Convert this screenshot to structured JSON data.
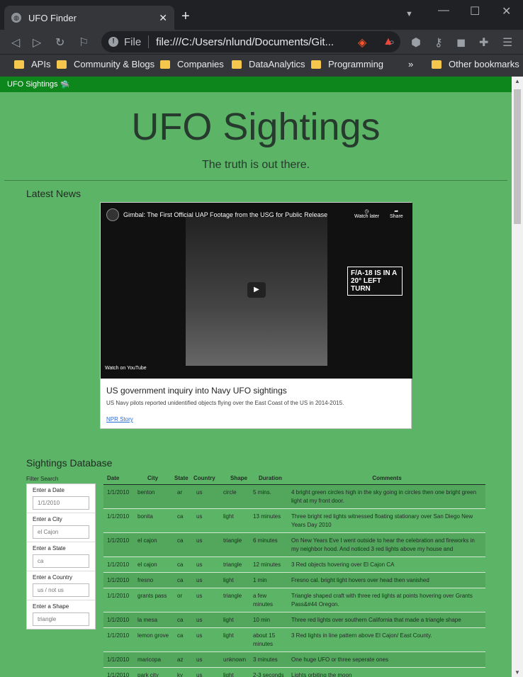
{
  "browser": {
    "tab_title": "UFO Finder",
    "address": "file:///C:/Users/nlund/Documents/Git...",
    "scheme_label": "File",
    "bookmarks": [
      "APIs",
      "Community & Blogs",
      "Companies",
      "DataAnalytics",
      "Programming"
    ],
    "other_bookmarks": "Other bookmarks"
  },
  "navbar": {
    "brand": "UFO Sightings"
  },
  "jumbotron": {
    "title": "UFO Sightings",
    "subtitle": "The truth is out there."
  },
  "news": {
    "heading": "Latest News",
    "video_title": "Gimbal: The First Official UAP Footage from the USG for Public Release",
    "overlay_text": "F/A-18 IS IN A 20° LEFT TURN",
    "watch_later": "Watch later",
    "share": "Share",
    "watch_on": "Watch on YouTube",
    "card_title": "US government inquiry into Navy UFO sightings",
    "card_text": "US Navy pilots reported unidentified objects flying over the East Coast of the US in 2014-2015.",
    "card_link": "NPR Story"
  },
  "database": {
    "heading": "Sightings Database",
    "filter_label": "Filter Search",
    "filters": [
      {
        "label": "Enter a Date",
        "placeholder": "1/1/2010"
      },
      {
        "label": "Enter a City",
        "placeholder": "el Cajon"
      },
      {
        "label": "Enter a State",
        "placeholder": "ca"
      },
      {
        "label": "Enter a Country",
        "placeholder": "us / not us"
      },
      {
        "label": "Enter a Shape",
        "placeholder": "triangle"
      }
    ],
    "columns": [
      "Date",
      "City",
      "State",
      "Country",
      "Shape",
      "Duration",
      "Comments"
    ],
    "rows": [
      [
        "1/1/2010",
        "benton",
        "ar",
        "us",
        "circle",
        "5 mins.",
        "4 bright green circles high in the sky going in circles then one bright green light at my front door."
      ],
      [
        "1/1/2010",
        "bonita",
        "ca",
        "us",
        "light",
        "13 minutes",
        "Three bright red lights witnessed floating stationary over San Diego New Years Day 2010"
      ],
      [
        "1/1/2010",
        "el cajon",
        "ca",
        "us",
        "triangle",
        "6 minutes",
        "On New Years Eve I went outside to hear the celebration and fireworks in my neighbor hood. And noticed 3 red lights above my house and"
      ],
      [
        "1/1/2010",
        "el cajon",
        "ca",
        "us",
        "triangle",
        "12 minutes",
        "3 Red objects hovering over El Cajon CA"
      ],
      [
        "1/1/2010",
        "fresno",
        "ca",
        "us",
        "light",
        "1 min",
        "Fresno cal. bright light hovers over head then vanished"
      ],
      [
        "1/1/2010",
        "grants pass",
        "or",
        "us",
        "triangle",
        "a few minutes",
        "Triangle shaped craft with three red lights at points hovering over Grants Pass&#44 Oregon."
      ],
      [
        "1/1/2010",
        "la mesa",
        "ca",
        "us",
        "light",
        "10 min",
        "Three red lights over southern California that made a triangle shape"
      ],
      [
        "1/1/2010",
        "lemon grove",
        "ca",
        "us",
        "light",
        "about 15 minutes",
        "3 Red lights in line pattern above El Cajon/ East County."
      ],
      [
        "1/1/2010",
        "maricopa",
        "az",
        "us",
        "unknown",
        "3 minutes",
        "One huge UFO or three seperate ones"
      ],
      [
        "1/1/2010",
        "park city",
        "ky",
        "us",
        "light",
        "2-3 seconds",
        "Lights orbiting the moon"
      ]
    ]
  }
}
